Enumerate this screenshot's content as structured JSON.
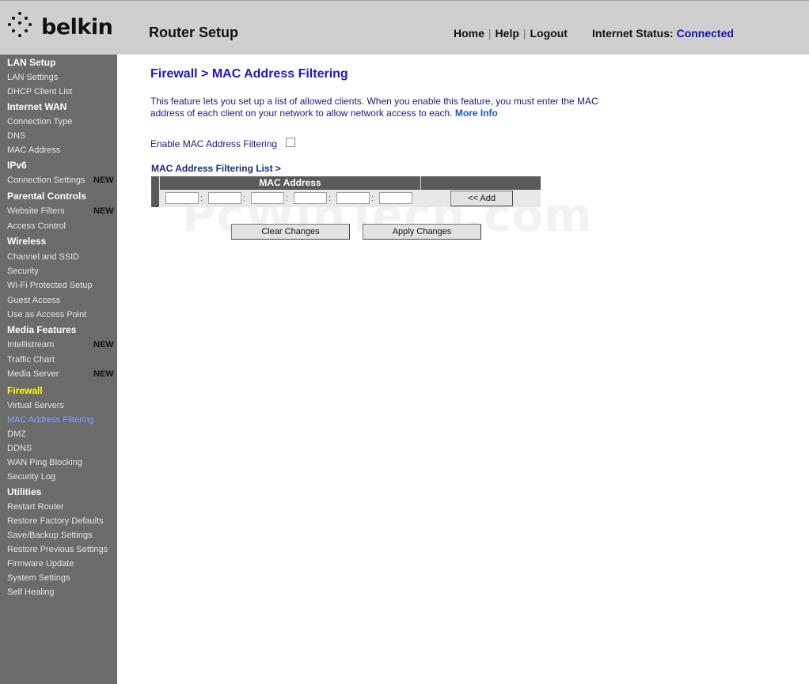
{
  "header": {
    "brand": "belkin",
    "app_title": "Router Setup",
    "nav": {
      "home": "Home",
      "help": "Help",
      "logout": "Logout",
      "sep": "|"
    },
    "status_label": "Internet Status:",
    "status_value": "Connected"
  },
  "sidebar": {
    "lan_setup": "LAN Setup",
    "lan_settings": "LAN Settings",
    "dhcp_client_list": "DHCP Client List",
    "internet_wan": "Internet WAN",
    "connection_type": "Connection Type",
    "dns": "DNS",
    "mac_address": "MAC Address",
    "ipv6": "IPv6",
    "connection_settings": "Connection Settings",
    "parental_controls": "Parental Controls",
    "website_filters": "Website Filters",
    "access_control": "Access Control",
    "wireless": "Wireless",
    "channel_ssid": "Channel and SSID",
    "security": "Security",
    "wps": "Wi-Fi Protected Setup",
    "guest_access": "Guest Access",
    "access_point": "Use as Access Point",
    "media_features": "Media Features",
    "intellistream": "Intellistream",
    "traffic_chart": "Traffic Chart",
    "media_server": "Media Server",
    "firewall": "Firewall",
    "virtual_servers": "Virtual Servers",
    "mac_filtering": "MAC Address Filtering",
    "dmz": "DMZ",
    "ddns": "DDNS",
    "wan_ping": "WAN Ping Blocking",
    "security_log": "Security Log",
    "utilities": "Utilities",
    "restart_router": "Restart Router",
    "restore_factory": "Restore Factory Defaults",
    "save_backup": "Save/Backup Settings",
    "restore_previous": "Restore Previous Settings",
    "firmware_update": "Firmware Update",
    "system_settings": "System Settings",
    "self_healing": "Self Healing",
    "new_badge": "NEW"
  },
  "main": {
    "title": "Firewall > MAC Address Filtering",
    "description": "This feature lets you set up a list of allowed clients. When you enable this feature, you must enter the MAC address of each client on your network to allow network access to each.",
    "more_info": "More Info",
    "enable_label": "Enable MAC Address Filtering",
    "enable_checked": false,
    "list_title": "MAC Address Filtering List >",
    "table_header": "MAC Address",
    "mac_fields": [
      "",
      "",
      "",
      "",
      "",
      ""
    ],
    "colon": ":",
    "add_button": "<< Add",
    "clear_button": "Clear Changes",
    "apply_button": "Apply Changes"
  },
  "watermark": "PcWinTech.com"
}
